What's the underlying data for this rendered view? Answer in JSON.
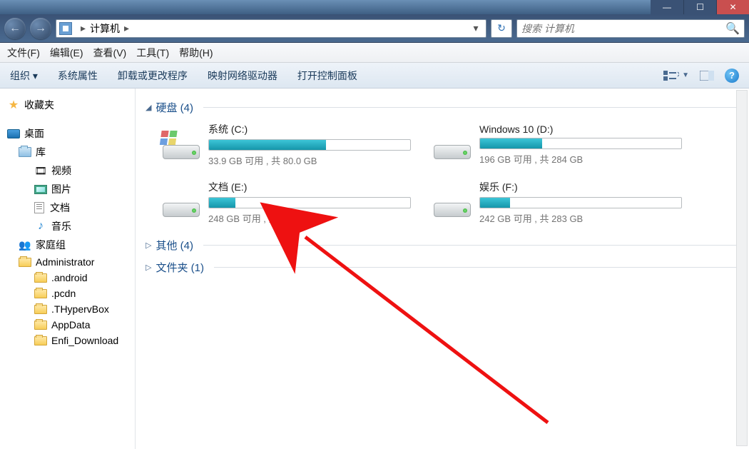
{
  "window": {
    "min_glyph": "—",
    "max_glyph": "☐",
    "close_glyph": "✕"
  },
  "navbar": {
    "back": "←",
    "fwd": "→",
    "path_sep": "▸",
    "location_label": "计算机",
    "dropdown": "▾",
    "refresh": "↻"
  },
  "search": {
    "placeholder": "搜索 计算机",
    "mag": "🔍"
  },
  "menubar": {
    "file": "文件(F)",
    "edit": "编辑(E)",
    "view": "查看(V)",
    "tools": "工具(T)",
    "help": "帮助(H)"
  },
  "toolbar": {
    "organize": "组织 ▾",
    "props": "系统属性",
    "uninstall": "卸载或更改程序",
    "mapdrive": "映射网络驱动器",
    "openctrl": "打开控制面板",
    "help_glyph": "?"
  },
  "sidebar": {
    "favorites": "收藏夹",
    "desktop": "桌面",
    "libraries": "库",
    "video": "视频",
    "pictures": "图片",
    "documents": "文档",
    "music": "音乐",
    "homegroup": "家庭组",
    "user": "Administrator",
    "folders": {
      "android": ".android",
      "pcdn": ".pcdn",
      "thyperv": ".THypervBox",
      "appdata": "AppData",
      "enfi": "Enfi_Download"
    }
  },
  "groups": {
    "hdd": "硬盘 (4)",
    "other": "其他 (4)",
    "folders": "文件夹 (1)"
  },
  "drives": {
    "c": {
      "name": "系统 (C:)",
      "text": "33.9 GB 可用 , 共 80.0 GB",
      "fill_pct": 58
    },
    "d": {
      "name": "Windows 10 (D:)",
      "text": "196 GB 可用 , 共 284 GB",
      "fill_pct": 31
    },
    "e": {
      "name": "文档 (E:)",
      "text": "248 GB 可用 , 共 284 GB",
      "fill_pct": 13
    },
    "f": {
      "name": "娱乐 (F:)",
      "text": "242 GB 可用 , 共 283 GB",
      "fill_pct": 15
    }
  }
}
